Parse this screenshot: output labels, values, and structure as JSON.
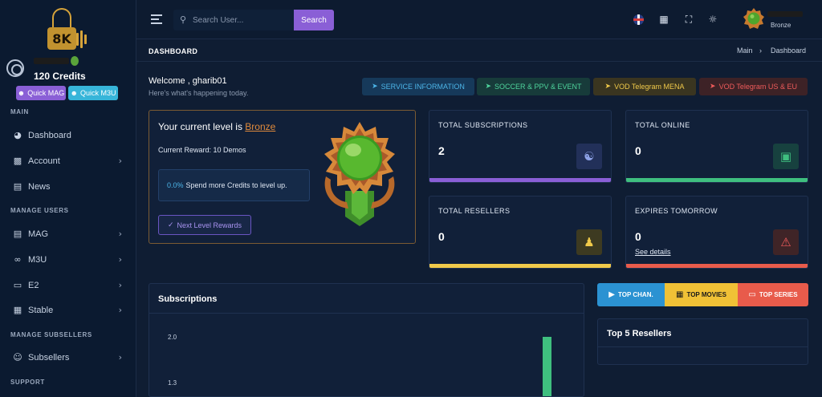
{
  "sidebar": {
    "logo_text": "8K",
    "credits": "120 Credits",
    "quick_mag": "Quick MAG",
    "quick_m3u": "Quick M3U",
    "sections": {
      "main": "MAIN",
      "manage_users": "MANAGE USERS",
      "manage_subsellers": "MANAGE SUBSELLERS",
      "support": "SUPPORT"
    },
    "items": [
      {
        "label": "Dashboard"
      },
      {
        "label": "Account"
      },
      {
        "label": "News"
      },
      {
        "label": "MAG"
      },
      {
        "label": "M3U"
      },
      {
        "label": "E2"
      },
      {
        "label": "Stable"
      },
      {
        "label": "Subsellers"
      }
    ]
  },
  "topbar": {
    "search_placeholder": "Search User...",
    "search_button": "Search",
    "profile_rank": "Bronze"
  },
  "pagehead": {
    "title": "DASHBOARD",
    "breadcrumb_main": "Main",
    "breadcrumb_sep": "›",
    "breadcrumb_current": "Dashboard"
  },
  "welcome": {
    "title": "Welcome , gharib01",
    "subtitle": "Here's what's happening today."
  },
  "telegram_buttons": [
    {
      "label": "SERVICE INFORMATION"
    },
    {
      "label": "SOCCER & PPV & EVENT"
    },
    {
      "label": "VOD Telegram MENA"
    },
    {
      "label": "VOD Telegram US & EU"
    }
  ],
  "level_card": {
    "title_prefix": "Your current level is ",
    "rank": "Bronze",
    "reward": "Current Reward: 10 Demos",
    "progress_pct": "0.0%",
    "progress_text": "Spend more Credits to level up.",
    "next_button": "Next Level Rewards"
  },
  "stats": {
    "subscriptions": {
      "label": "TOTAL SUBSCRIPTIONS",
      "value": "2"
    },
    "online": {
      "label": "TOTAL ONLINE",
      "value": "0"
    },
    "resellers": {
      "label": "TOTAL RESELLERS",
      "value": "0"
    },
    "expires": {
      "label": "EXPIRES TOMORROW",
      "value": "0",
      "link": "See details"
    }
  },
  "colors": {
    "purple": "#8a5fd6",
    "green": "#3fbf7f",
    "yellow": "#f0c94a",
    "red": "#e85b4b",
    "bronze": "#e08a3c"
  },
  "subscriptions_card": {
    "title": "Subscriptions"
  },
  "chart_data": {
    "type": "bar",
    "title": "Subscriptions",
    "y_ticks": [
      "2.0",
      "1.3"
    ],
    "y_tick_values": [
      2.0,
      1.3
    ],
    "visible_bar_value": 2,
    "bar_color": "#3fbf7f"
  },
  "media_buttons": [
    {
      "label": "TOP CHAN.",
      "icon": "play-icon"
    },
    {
      "label": "TOP MOVIES",
      "icon": "film-icon"
    },
    {
      "label": "TOP SERIES",
      "icon": "tv-icon"
    }
  ],
  "resellers_card": {
    "title": "Top 5 Resellers"
  }
}
